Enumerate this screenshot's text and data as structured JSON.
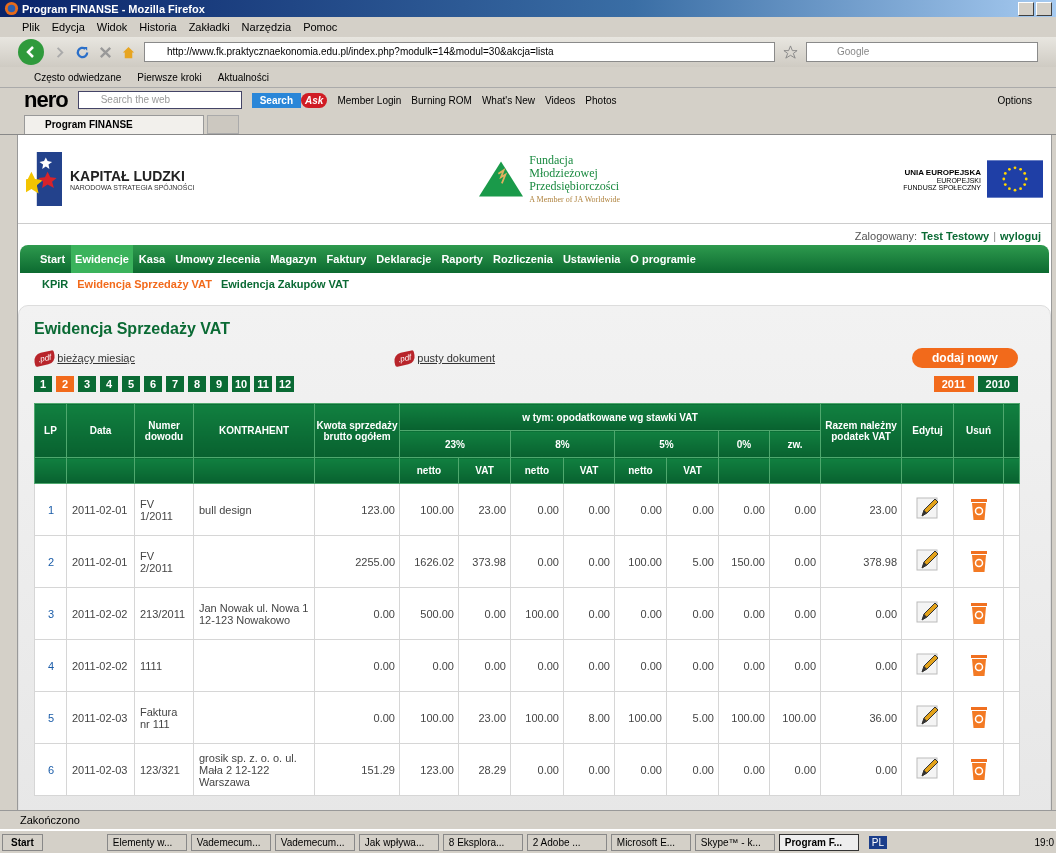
{
  "browser": {
    "title": "Program FINANSE - Mozilla Firefox",
    "menu": [
      "Plik",
      "Edycja",
      "Widok",
      "Historia",
      "Zakładki",
      "Narzędzia",
      "Pomoc"
    ],
    "url": "http://www.fk.praktycznaekonomia.edu.pl/index.php?modulk=14&modul=30&akcja=lista",
    "search_placeholder": "Google",
    "bookmarks": [
      "Często odwiedzane",
      "Pierwsze kroki",
      "Aktualności"
    ],
    "nero": {
      "logo": "nero",
      "search_placeholder": "Search the web",
      "search_button": "Search",
      "ask": "Ask",
      "items": [
        "Member Login",
        "Burning ROM",
        "What's New",
        "Videos",
        "Photos"
      ],
      "options": "Options"
    },
    "tab": "Program FINANSE",
    "status": "Zakończono"
  },
  "header": {
    "kl_title": "KAPITAŁ LUDZKI",
    "kl_sub": "NARODOWA STRATEGIA SPÓJNOŚCI",
    "fmp": [
      "Fundacja",
      "Młodzieżowej",
      "Przedsiębiorczości"
    ],
    "fmp_sub": "A Member of JA Worldwide",
    "eu_title": "UNIA EUROPEJSKA",
    "eu_sub": [
      "EUROPEJSKI",
      "FUNDUSZ SPOŁECZNY"
    ]
  },
  "login": {
    "label": "Zalogowany:",
    "user": "Test Testowy",
    "separator": "|",
    "logout": "wyloguj"
  },
  "nav": [
    {
      "label": "Start",
      "selected": false
    },
    {
      "label": "Ewidencje",
      "selected": true
    },
    {
      "label": "Kasa",
      "selected": false
    },
    {
      "label": "Umowy zlecenia",
      "selected": false
    },
    {
      "label": "Magazyn",
      "selected": false
    },
    {
      "label": "Faktury",
      "selected": false
    },
    {
      "label": "Deklaracje",
      "selected": false
    },
    {
      "label": "Raporty",
      "selected": false
    },
    {
      "label": "Rozliczenia",
      "selected": false
    },
    {
      "label": "Ustawienia",
      "selected": false
    },
    {
      "label": "O programie",
      "selected": false
    }
  ],
  "subnav": [
    {
      "label": "KPiR",
      "selected": false
    },
    {
      "label": "Ewidencja Sprzedaży VAT",
      "selected": true
    },
    {
      "label": "Ewidencja Zakupów VAT",
      "selected": false
    }
  ],
  "title": "Ewidencja Sprzedaży VAT",
  "links": [
    {
      "pdf": ".pdf",
      "label": "bieżący miesiąc"
    },
    {
      "pdf": ".pdf",
      "label": "pusty dokument"
    }
  ],
  "add_button": "dodaj nowy",
  "pages": [
    {
      "label": "1",
      "selected": false
    },
    {
      "label": "2",
      "selected": true
    },
    {
      "label": "3",
      "selected": false
    },
    {
      "label": "4",
      "selected": false
    },
    {
      "label": "5",
      "selected": false
    },
    {
      "label": "6",
      "selected": false
    },
    {
      "label": "7",
      "selected": false
    },
    {
      "label": "8",
      "selected": false
    },
    {
      "label": "9",
      "selected": false
    },
    {
      "label": "10",
      "selected": false
    },
    {
      "label": "11",
      "selected": false
    },
    {
      "label": "12",
      "selected": false
    }
  ],
  "years": [
    {
      "label": "2011",
      "selected": true
    },
    {
      "label": "2010",
      "selected": false
    }
  ],
  "table": {
    "head": {
      "lp": "LP",
      "date": "Data",
      "doc": "Numer dowodu",
      "contractor": "KONTRAHENT",
      "gross": "Kwota sprzedaży brutto ogółem",
      "group": "w tym: opodatkowane wg stawki VAT",
      "tax": "Razem należny podatek VAT",
      "edit": "Edytuj",
      "delete": "Usuń"
    },
    "rates": [
      "23%",
      "8%",
      "5%",
      "0%",
      "zw."
    ],
    "sub": [
      "netto",
      "VAT",
      "netto",
      "VAT",
      "netto",
      "VAT"
    ],
    "rows": [
      {
        "lp": "1",
        "date": "2011-02-01",
        "doc": "FV 1/2011",
        "contractor": "bull design",
        "gross": "123.00",
        "values": [
          "100.00",
          "23.00",
          "0.00",
          "0.00",
          "0.00",
          "0.00",
          "0.00",
          "0.00"
        ],
        "tax": "23.00"
      },
      {
        "lp": "2",
        "date": "2011-02-01",
        "doc": "FV 2/2011",
        "contractor": "",
        "gross": "2255.00",
        "values": [
          "1626.02",
          "373.98",
          "0.00",
          "0.00",
          "100.00",
          "5.00",
          "150.00",
          "0.00"
        ],
        "tax": "378.98"
      },
      {
        "lp": "3",
        "date": "2011-02-02",
        "doc": "213/2011",
        "contractor": "Jan Nowak ul. Nowa 1 12-123 Nowakowo",
        "gross": "0.00",
        "values": [
          "500.00",
          "0.00",
          "100.00",
          "0.00",
          "0.00",
          "0.00",
          "0.00",
          "0.00"
        ],
        "tax": "0.00"
      },
      {
        "lp": "4",
        "date": "2011-02-02",
        "doc": "1111",
        "contractor": "",
        "gross": "0.00",
        "values": [
          "0.00",
          "0.00",
          "0.00",
          "0.00",
          "0.00",
          "0.00",
          "0.00",
          "0.00"
        ],
        "tax": "0.00"
      },
      {
        "lp": "5",
        "date": "2011-02-03",
        "doc": "Faktura nr 111",
        "contractor": "",
        "gross": "0.00",
        "values": [
          "100.00",
          "23.00",
          "100.00",
          "8.00",
          "100.00",
          "5.00",
          "100.00",
          "100.00"
        ],
        "tax": "36.00"
      },
      {
        "lp": "6",
        "date": "2011-02-03",
        "doc": "123/321",
        "contractor": "grosik sp. z. o. o. ul. Mała 2 12-122 Warszawa",
        "gross": "151.29",
        "values": [
          "123.00",
          "28.29",
          "0.00",
          "0.00",
          "0.00",
          "0.00",
          "0.00",
          "0.00"
        ],
        "tax": "0.00"
      }
    ]
  },
  "taskbar": {
    "start": "Start",
    "items": [
      {
        "label": "Elementy w...",
        "selected": false
      },
      {
        "label": "Vademecum...",
        "selected": false
      },
      {
        "label": "Vademecum...",
        "selected": false
      },
      {
        "label": "Jak wpływa...",
        "selected": false
      },
      {
        "label": "8 Eksplora...",
        "selected": false
      },
      {
        "label": "2 Adobe ...",
        "selected": false
      },
      {
        "label": "Microsoft E...",
        "selected": false
      },
      {
        "label": "Skype™ - k...",
        "selected": false
      },
      {
        "label": "Program F...",
        "selected": true
      }
    ],
    "lang": "PL",
    "clock": "19:0"
  }
}
